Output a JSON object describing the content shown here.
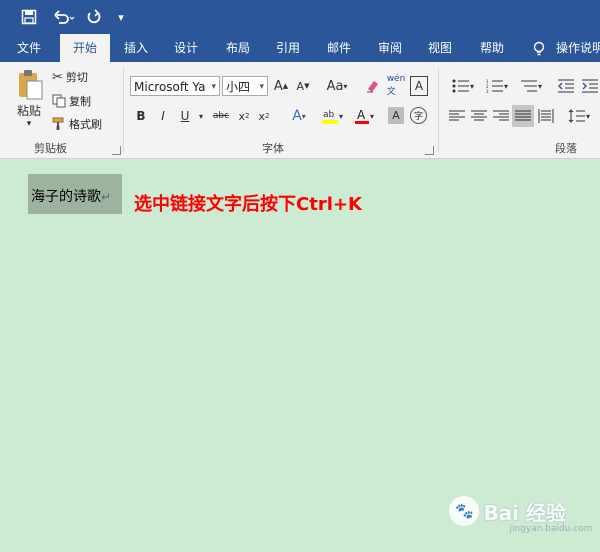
{
  "qat": {
    "save_icon": "save-icon",
    "undo_icon": "undo-icon",
    "redo_icon": "redo-icon",
    "customize_icon": "customize-qat-icon"
  },
  "tabs": [
    {
      "label": "文件",
      "active": false
    },
    {
      "label": "开始",
      "active": true
    },
    {
      "label": "插入",
      "active": false
    },
    {
      "label": "设计",
      "active": false
    },
    {
      "label": "布局",
      "active": false
    },
    {
      "label": "引用",
      "active": false
    },
    {
      "label": "邮件",
      "active": false
    },
    {
      "label": "审阅",
      "active": false
    },
    {
      "label": "视图",
      "active": false
    },
    {
      "label": "帮助",
      "active": false
    }
  ],
  "tell_me": "操作说明",
  "clipboard": {
    "paste_label": "粘贴",
    "cut_label": "剪切",
    "copy_label": "复制",
    "format_painter_label": "格式刷",
    "group_label": "剪贴板"
  },
  "font": {
    "font_name": "Microsoft Ya",
    "font_size": "小四",
    "group_label": "字体"
  },
  "paragraph": {
    "group_label": "段落"
  },
  "document": {
    "selected_text": "海子的诗歌",
    "paragraph_mark": "↵",
    "annotation": "选中链接文字后按下Ctrl+K"
  },
  "watermark": {
    "brand": "Bai 经验",
    "sub": "jingyan.baidu.com"
  },
  "colors": {
    "ribbon_blue": "#2b579a",
    "annotation_red": "#ff0000",
    "page_green": "#cdebd2",
    "selection": "#9eb39f"
  }
}
